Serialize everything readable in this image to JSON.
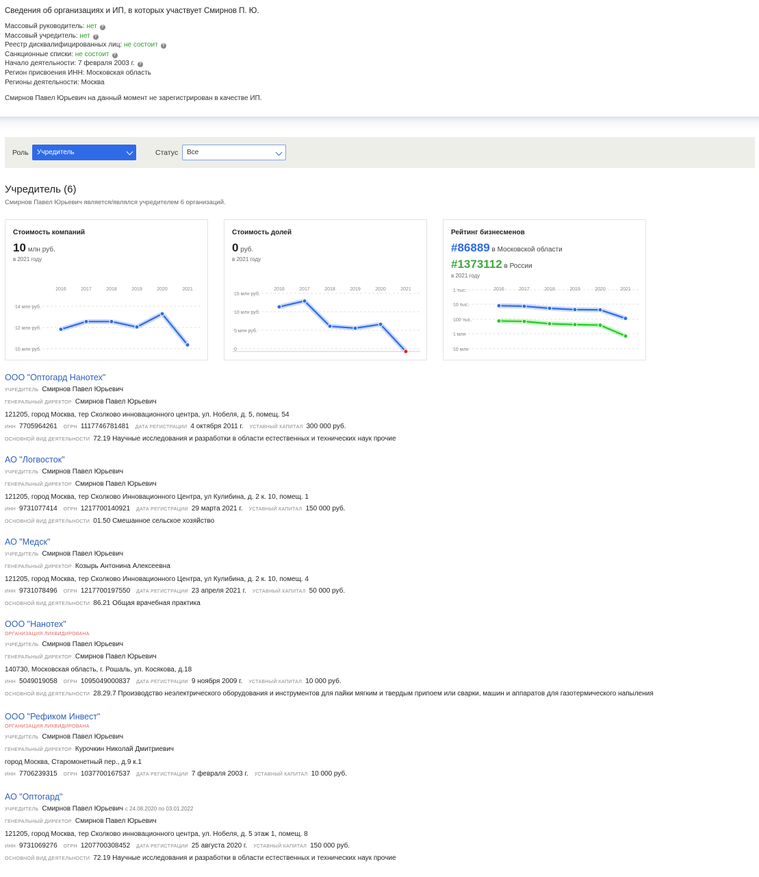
{
  "info": {
    "title": "Сведения об организациях и ИП, в которых участвует Смирнов П. Ю.",
    "rows": [
      {
        "label": "Массовый руководитель: ",
        "value": "нет",
        "green": true,
        "q": true
      },
      {
        "label": "Массовый учредитель: ",
        "value": "нет",
        "green": true,
        "q": true
      },
      {
        "label": "Реестр дисквалифицированных лиц: ",
        "value": "не состоит",
        "green": true,
        "q": true
      },
      {
        "label": "Санкционные списки: ",
        "value": "не состоит",
        "green": true,
        "q": true
      },
      {
        "label": "Начало деятельности: ",
        "value": "7 февраля 2003 г.",
        "green": false,
        "q": true
      },
      {
        "label": "Регион присвоения ИНН: ",
        "value": "Московская область",
        "green": false,
        "q": false
      },
      {
        "label": "Регионы деятельности: ",
        "value": "Москва",
        "green": false,
        "q": false
      }
    ],
    "note": "Смирнов Павел Юрьевич на данный момент не зарегистрирован в качестве ИП."
  },
  "filters": {
    "role_label": "Роль",
    "role_value": "Учредитель",
    "status_label": "Статус",
    "status_value": "Все"
  },
  "section": {
    "title": "Учредитель (6)",
    "subtitle": "Смирнов Павел Юрьевич является/являлся учредителем 6 организаций."
  },
  "cards": {
    "company_value": {
      "title": "Стоимость компаний",
      "big": "10",
      "unit": " млн руб.",
      "year": "в 2021 году"
    },
    "share_value": {
      "title": "Стоимость долей",
      "big": "0",
      "unit": " руб.",
      "year": "в 2021 году"
    },
    "rating": {
      "title": "Рейтинг бизнесменов",
      "regional": "#86889",
      "regional_label": " в Московской области",
      "national": "#1373112",
      "national_label": " в России",
      "year": "в 2021 году"
    }
  },
  "chart_data": [
    {
      "type": "line",
      "title": "Стоимость компаний",
      "x": [
        "2016",
        "2017",
        "2018",
        "2019",
        "2020",
        "2021"
      ],
      "y_ticks": [
        "14 млн руб.",
        "12 млн руб.",
        "10 млн руб."
      ],
      "ylim": [
        9.5,
        15.5
      ],
      "series": [
        {
          "values": [
            12.0,
            13.0,
            13.0,
            12.3,
            14.0,
            10.0
          ],
          "color": "#2f6be8"
        }
      ]
    },
    {
      "type": "line",
      "title": "Стоимость долей",
      "x": [
        "2016",
        "2017",
        "2018",
        "2019",
        "2020",
        "2021"
      ],
      "y_ticks": [
        "15 млн руб.",
        "10 млн руб.",
        "5 млн руб.",
        "0"
      ],
      "ylim": [
        0,
        15
      ],
      "series": [
        {
          "values": [
            11.5,
            13.0,
            6.5,
            6.0,
            7.0,
            0
          ],
          "color": "#2f6be8",
          "last_point_color": "#e02020"
        }
      ]
    },
    {
      "type": "line",
      "title": "Рейтинг бизнесменов",
      "x": [
        "2016",
        "2017",
        "2018",
        "2019",
        "2020",
        "2021"
      ],
      "y_ticks": [
        "1 тыс.",
        "10 тыс.",
        "100 тыс.",
        "1 млн",
        "10 млн"
      ],
      "scale": "log",
      "inverted": true,
      "ylim": [
        1000,
        10000000
      ],
      "series": [
        {
          "values": [
            12000,
            13000,
            18000,
            22000,
            23000,
            86889
          ],
          "color": "#2f6be8"
        },
        {
          "values": [
            130000,
            140000,
            200000,
            230000,
            250000,
            1373112
          ],
          "color": "#22cc22"
        }
      ]
    }
  ],
  "org_labels": {
    "founder": "учредитель",
    "director": "генеральный директор",
    "inn": "инн",
    "ogrn": "огрн",
    "reg": "дата регистрации",
    "capital": "уставный капитал",
    "activity": "основной вид деятельности",
    "liquidated": "организация ликвидирована"
  },
  "orgs": [
    {
      "name": "ООО \"Оптогард Нанотех\"",
      "liquidated": false,
      "founder": "Смирнов Павел Юрьевич",
      "founder_period": "",
      "director": "Смирнов Павел Юрьевич",
      "address": "121205, город Москва, тер Сколково инновационного центра, ул. Нобеля, д. 5, помещ. 54",
      "inn": "7705964261",
      "ogrn": "1117746781481",
      "reg": "4 октября 2011 г.",
      "capital": "300 000 руб.",
      "activity": "72.19 Научные исследования и разработки в области естественных и технических наук прочие"
    },
    {
      "name": "АО \"Логвосток\"",
      "liquidated": false,
      "founder": "Смирнов Павел Юрьевич",
      "founder_period": "",
      "director": "Смирнов Павел Юрьевич",
      "address": "121205, город Москва, тер Сколково Инновационного Центра, ул Кулибина, д. 2 к. 10, помещ. 1",
      "inn": "9731077414",
      "ogrn": "1217700140921",
      "reg": "29 марта 2021 г.",
      "capital": "150 000 руб.",
      "activity": "01.50 Смешанное сельское хозяйство"
    },
    {
      "name": "АО \"Медск\"",
      "liquidated": false,
      "founder": "Смирнов Павел Юрьевич",
      "founder_period": "",
      "director": "Козырь Антонина Алексеевна",
      "address": "121205, город Москва, тер Сколково Инновационного Центра, ул Кулибина, д. 2 к. 10, помещ. 4",
      "inn": "9731078496",
      "ogrn": "1217700197550",
      "reg": "23 апреля 2021 г.",
      "capital": "50 000 руб.",
      "activity": "86.21 Общая врачебная практика"
    },
    {
      "name": "ООО \"Нанотех\"",
      "liquidated": true,
      "founder": "Смирнов Павел Юрьевич",
      "founder_period": "",
      "director": "Смирнов Павел Юрьевич",
      "address": "140730, Московская область, г. Рошаль, ул. Косякова, д.18",
      "inn": "5049019058",
      "ogrn": "1095049000837",
      "reg": "9 ноября 2009 г.",
      "capital": "10 000 руб.",
      "activity": "28.29.7 Производство неэлектрического оборудования и инструментов для пайки мягким и твердым припоем или сварки, машин и аппаратов для газотермического напыления"
    },
    {
      "name": "ООО \"Рефиком Инвест\"",
      "liquidated": true,
      "founder": "Смирнов Павел Юрьевич",
      "founder_period": "",
      "director": "Курочкин Николай Дмитриевич",
      "address": "город Москва, Старомонетный пер., д.9 к.1",
      "inn": "7706239315",
      "ogrn": "1037700167537",
      "reg": "7 февраля 2003 г.",
      "capital": "10 000 руб.",
      "activity": ""
    },
    {
      "name": "АО \"Оптогард\"",
      "liquidated": false,
      "founder": "Смирнов Павел Юрьевич",
      "founder_period": "с 24.08.2020 по 03.01.2022",
      "director": "Смирнов Павел Юрьевич",
      "address": "121205, город Москва, тер Сколково инновационного центра, ул. Нобеля, д. 5 этаж 1, помещ. 8",
      "inn": "9731069276",
      "ogrn": "1207700308452",
      "reg": "25 августа 2020 г.",
      "capital": "150 000 руб.",
      "activity": "72.19 Научные исследования и разработки в области естественных и технических наук прочие"
    }
  ]
}
